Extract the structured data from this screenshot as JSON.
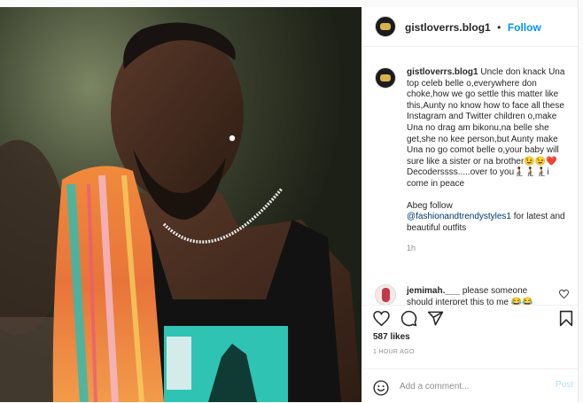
{
  "post": {
    "username": "gistloverrs.blog1",
    "follow_label": "Follow",
    "separator": "•"
  },
  "caption": {
    "username": "gistloverrs.blog1",
    "body": " Uncle don knack Una top celeb belle o,everywhere don choke,how we go settle this matter like this,Aunty no know how to face all these Instagram and Twitter children o,make Una no drag am bikonu,na belle she get,she no kee person,but Aunty make Una no go comot belle o,your baby will sure like a sister or na brother😉😉❤️ Decoderssss.....over to you🧎🏿🧎🏿🧎🏿i come in peace",
    "follow_prefix": "Abeg follow",
    "follow_handle": "@fashionandtrendystyles1",
    "follow_suffix": " for latest and beautiful outfits",
    "age": "1h"
  },
  "comment": {
    "username": "jemimah.___",
    "text": " please someone should interpret this to me 😂😂"
  },
  "actions": {
    "likes": "587 likes",
    "timestamp": "1 HOUR AGO"
  },
  "composer": {
    "placeholder": "Add a comment...",
    "post_label": "Post"
  },
  "colors": {
    "accent": "#0095f6",
    "post_disabled": "#b2dffc",
    "text": "#262626",
    "muted": "#8e8e8e"
  },
  "icons": [
    "heart-icon",
    "comment-icon",
    "share-icon",
    "bookmark-icon",
    "emoji-icon",
    "small-heart-icon"
  ]
}
